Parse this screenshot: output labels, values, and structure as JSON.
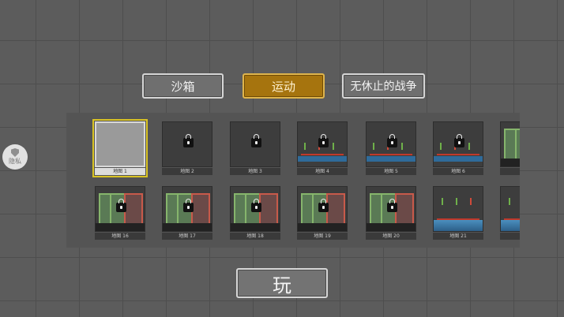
{
  "tabs": {
    "sandbox": "沙箱",
    "sports": "运动",
    "endless_war": "无休止的战争",
    "active": "sports"
  },
  "levels": {
    "row1": [
      {
        "label": "地图 1",
        "locked": false,
        "selected": true,
        "thumb": "plain"
      },
      {
        "label": "地图 2",
        "locked": true,
        "selected": false,
        "thumb": "dark"
      },
      {
        "label": "地图 3",
        "locked": true,
        "selected": false,
        "thumb": "dark"
      },
      {
        "label": "地图 4",
        "locked": true,
        "selected": false,
        "thumb": "pool"
      },
      {
        "label": "地图 5",
        "locked": true,
        "selected": false,
        "thumb": "pool"
      },
      {
        "label": "地图 6",
        "locked": true,
        "selected": false,
        "thumb": "pool"
      },
      {
        "label": "",
        "locked": false,
        "selected": false,
        "thumb": "partial"
      }
    ],
    "row2": [
      {
        "label": "地图 16",
        "locked": true,
        "selected": false,
        "thumb": "walls"
      },
      {
        "label": "地图 17",
        "locked": true,
        "selected": false,
        "thumb": "walls"
      },
      {
        "label": "地图 18",
        "locked": true,
        "selected": false,
        "thumb": "walls"
      },
      {
        "label": "地图 19",
        "locked": true,
        "selected": false,
        "thumb": "walls"
      },
      {
        "label": "地图 20",
        "locked": true,
        "selected": false,
        "thumb": "walls"
      },
      {
        "label": "地图 21",
        "locked": false,
        "selected": false,
        "thumb": "sea"
      },
      {
        "label": "",
        "locked": false,
        "selected": false,
        "thumb": "partial-sea"
      }
    ]
  },
  "privacy": {
    "label": "隐私",
    "icon": "shield-icon"
  },
  "play": {
    "label": "玩"
  }
}
